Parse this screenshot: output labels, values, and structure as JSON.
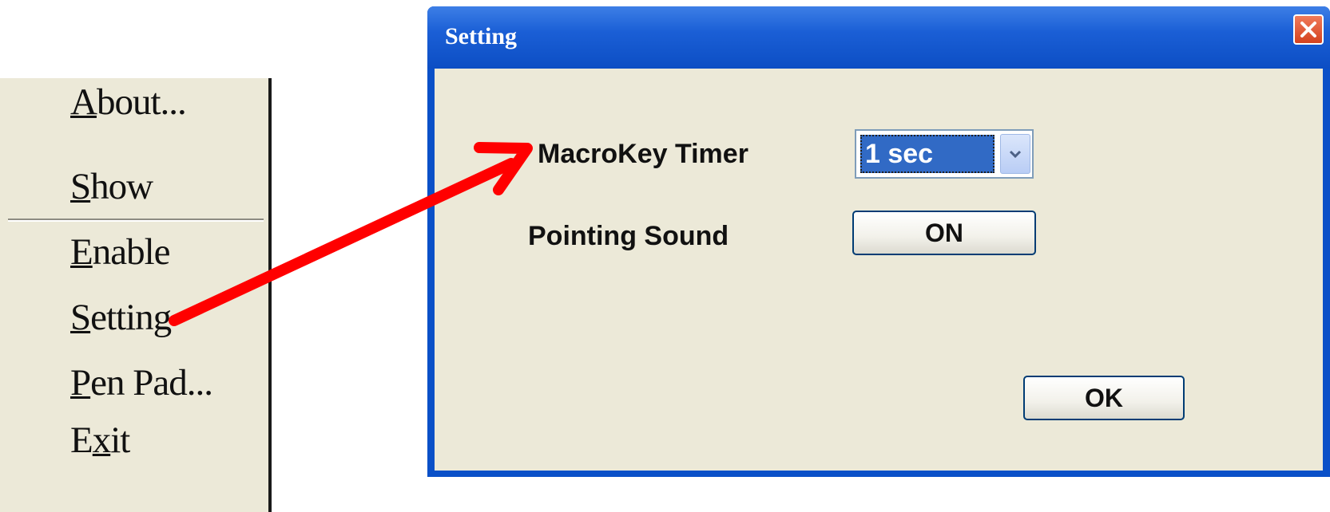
{
  "context_menu": {
    "items": [
      {
        "label": "About...",
        "mnemonic": "A"
      },
      {
        "label": "Show",
        "mnemonic": "S"
      },
      {
        "label": "Enable",
        "mnemonic": "E"
      },
      {
        "label": "Setting",
        "mnemonic": "S"
      },
      {
        "label": "Pen Pad...",
        "mnemonic": "P"
      },
      {
        "label": "Exit",
        "mnemonic": "x"
      }
    ]
  },
  "dialog": {
    "title": "Setting",
    "macrokey_timer_label": "MacroKey Timer",
    "macrokey_timer_value": "1 sec",
    "pointing_sound_label": "Pointing Sound",
    "pointing_sound_button": "ON",
    "ok_button": "OK"
  },
  "colors": {
    "titlebar": "#0c4ec4",
    "dialog_face": "#ece9d8",
    "arrow": "#ff0000",
    "close_button": "#d4421f",
    "selection": "#316ac5"
  },
  "icons": {
    "close": "close-x-icon",
    "dropdown": "chevron-down-icon",
    "pointer": "red-arrow-annotation"
  }
}
